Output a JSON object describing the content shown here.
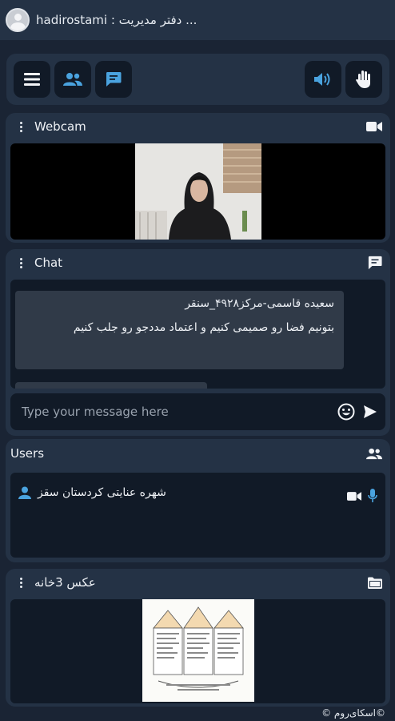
{
  "header": {
    "username": "hadirostami",
    "title": "hadirostami : دفتر مدیریت ..."
  },
  "toolbar": {
    "left_buttons": [
      "menu-icon",
      "users-icon",
      "chat-icon"
    ],
    "right_buttons": [
      "speaker-icon",
      "raise-hand-icon"
    ],
    "accent": "#4aa3df"
  },
  "webcam": {
    "title": "Webcam",
    "icon": "video-camera-icon"
  },
  "chat": {
    "title": "Chat",
    "icon": "chat-icon",
    "messages": [
      {
        "sender": "سعیده قاسمی-مرکز۴۹۲۸_سنقر",
        "text": "بتونیم فضا رو صمیمی کنیم و اعتماد مددجو رو جلب کنیم"
      }
    ],
    "input_placeholder": "Type your message here"
  },
  "users": {
    "title": "Users",
    "list": [
      {
        "name": "شهره عنایتی کردستان سقز"
      }
    ]
  },
  "photo_panel": {
    "title": "عکس 3خانه",
    "icon": "folder-image-icon"
  },
  "footer": {
    "text": "©اسکای‌روم ©"
  }
}
